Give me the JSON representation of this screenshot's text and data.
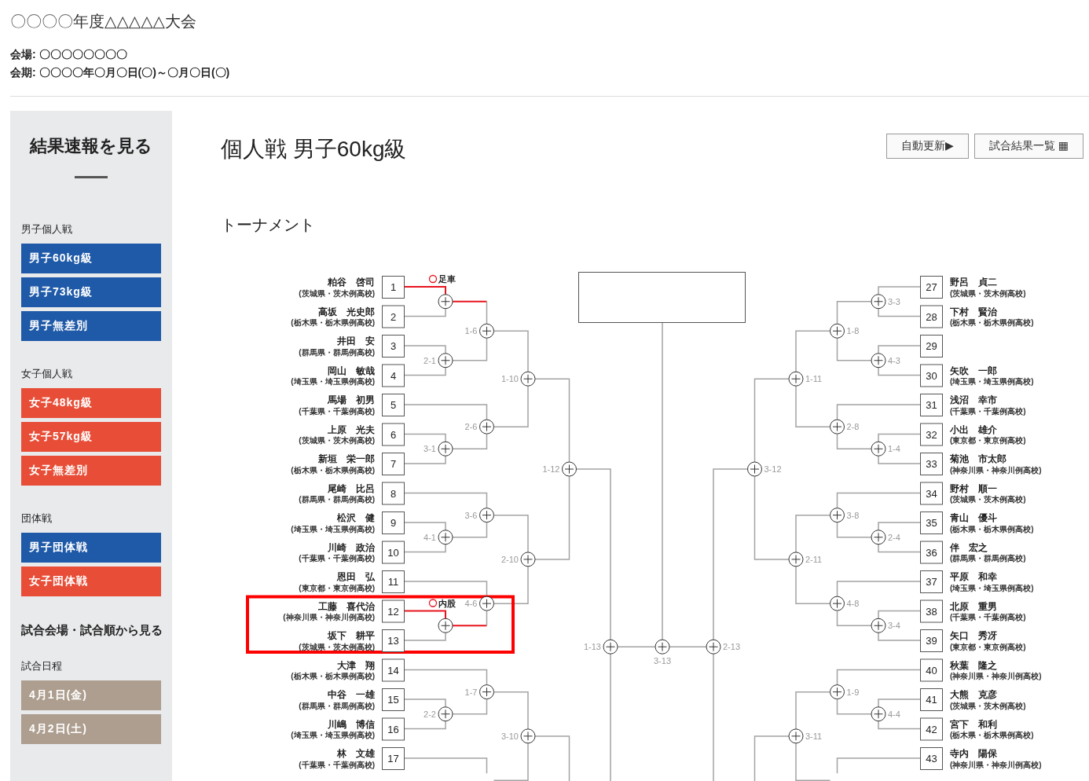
{
  "header": {
    "title": "〇〇〇〇年度△△△△△大会",
    "info": [
      "会場: 〇〇〇〇〇〇〇〇",
      "会期: 〇〇〇〇年〇月〇日(〇)～〇月〇日(〇)"
    ]
  },
  "sidebar": {
    "title": "結果速報を見る",
    "groups": [
      {
        "heading": "男子個人戦",
        "items": [
          {
            "label": "男子60kg級",
            "color": "#1f5aa8"
          },
          {
            "label": "男子73kg級",
            "color": "#1f5aa8"
          },
          {
            "label": "男子無差別",
            "color": "#1f5aa8"
          }
        ]
      },
      {
        "heading": "女子個人戦",
        "items": [
          {
            "label": "女子48kg級",
            "color": "#e84e37"
          },
          {
            "label": "女子57kg級",
            "color": "#e84e37"
          },
          {
            "label": "女子無差別",
            "color": "#e84e37"
          }
        ]
      },
      {
        "heading": "団体戦",
        "items": [
          {
            "label": "男子団体戦",
            "color": "#1f5aa8"
          },
          {
            "label": "女子団体戦",
            "color": "#e84e37"
          }
        ]
      }
    ],
    "section_title": "試合会場・試合順から見る",
    "schedule": {
      "heading": "試合日程",
      "items": [
        {
          "label": "4月1日(金)",
          "color": "#ad9e8f"
        },
        {
          "label": "4月2日(土)",
          "color": "#ad9e8f"
        }
      ]
    }
  },
  "page_title": "個人戦 男子60kg級",
  "toolbar": {
    "buttons": [
      "自動更新▶",
      "試合結果一覧 ▦"
    ]
  },
  "section_heading": "トーナメント",
  "bracket": {
    "left": {
      "entries": [
        {
          "number": "1",
          "name": "粕谷　啓司",
          "school": "(茨城県・茨木例高校)",
          "winner": true
        },
        {
          "number": "2",
          "name": "高坂　光史郎",
          "school": "(栃木県・栃木県例高校)",
          "winner": false
        },
        {
          "number": "3",
          "name": "井田　安",
          "school": "(群馬県・群馬例高校)",
          "winner": false
        },
        {
          "number": "4",
          "name": "岡山　敏哉",
          "school": "(埼玉県・埼玉県例高校)",
          "winner": false
        },
        {
          "number": "5",
          "name": "馬場　初男",
          "school": "(千葉県・千葉例高校)",
          "winner": false
        },
        {
          "number": "6",
          "name": "上原　光夫",
          "school": "(茨城県・茨木例高校)",
          "winner": false
        },
        {
          "number": "7",
          "name": "新垣　栄一郎",
          "school": "(栃木県・栃木県例高校)",
          "winner": false
        },
        {
          "number": "8",
          "name": "尾崎　比呂",
          "school": "(群馬県・群馬例高校)",
          "winner": false
        },
        {
          "number": "9",
          "name": "松沢　健",
          "school": "(埼玉県・埼玉県例高校)",
          "winner": false
        },
        {
          "number": "10",
          "name": "川崎　政治",
          "school": "(千葉県・千葉例高校)",
          "winner": false
        },
        {
          "number": "11",
          "name": "恩田　弘",
          "school": "(東京都・東京例高校)",
          "winner": false
        },
        {
          "number": "12",
          "name": "工藤　喜代治",
          "school": "(神奈川県・神奈川例高校)",
          "winner": true
        },
        {
          "number": "13",
          "name": "坂下　耕平",
          "school": "(茨城県・茨木例高校)",
          "winner": false
        },
        {
          "number": "14",
          "name": "大津　翔",
          "school": "(栃木県・栃木県例高校)",
          "winner": false
        },
        {
          "number": "15",
          "name": "中谷　一雄",
          "school": "(群馬県・群馬例高校)",
          "winner": false
        },
        {
          "number": "16",
          "name": "川嶋　博信",
          "school": "(埼玉県・埼玉県例高校)",
          "winner": false
        },
        {
          "number": "17",
          "name": "林　文雄",
          "school": "(千葉県・千葉例高校)",
          "winner": false
        }
      ],
      "matches": [
        {
          "result": "足車",
          "highlighted": false
        },
        {
          "label": "1-6",
          "highlighted": false
        },
        {
          "label": "2-1",
          "highlighted": false
        },
        {
          "label": "1-10",
          "highlighted": false
        },
        {
          "label": "2-6",
          "highlighted": false
        },
        {
          "label": "3-1",
          "highlighted": false
        },
        {
          "label": "1-12",
          "highlighted": false
        },
        {
          "label": "3-6",
          "highlighted": false
        },
        {
          "label": "4-1",
          "highlighted": false
        },
        {
          "label": "2-10",
          "highlighted": false
        },
        {
          "label": "4-6",
          "highlighted": false
        },
        {
          "result": "内股",
          "highlighted": true
        },
        {
          "label": "1-13",
          "highlighted": false
        },
        {
          "label": "1-7",
          "highlighted": false
        },
        {
          "label": "2-2",
          "highlighted": false
        },
        {
          "label": "3-10",
          "highlighted": false
        }
      ]
    },
    "final": {
      "label": "3-13"
    },
    "right": {
      "entries": [
        {
          "number": "27",
          "name": "野呂　貞二",
          "school": "(茨城県・茨木例高校)",
          "winner": false
        },
        {
          "number": "28",
          "name": "下村　賢治",
          "school": "(栃木県・栃木県例高校)",
          "winner": false
        },
        {
          "number": "29",
          "winner": false
        },
        {
          "number": "30",
          "name": "矢吹　一郎",
          "school": "(埼玉県・埼玉県例高校)",
          "winner": false
        },
        {
          "number": "31",
          "name": "浅沼　幸市",
          "school": "(千葉県・千葉例高校)",
          "winner": false
        },
        {
          "number": "32",
          "name": "小出　雄介",
          "school": "(東京都・東京例高校)",
          "winner": false
        },
        {
          "number": "33",
          "name": "菊池　市太郎",
          "school": "(神奈川県・神奈川例高校)",
          "winner": false
        },
        {
          "number": "34",
          "name": "野村　順一",
          "school": "(茨城県・茨木例高校)",
          "winner": false
        },
        {
          "number": "35",
          "name": "青山　優斗",
          "school": "(栃木県・栃木県例高校)",
          "winner": false
        },
        {
          "number": "36",
          "name": "伴　宏之",
          "school": "(群馬県・群馬例高校)",
          "winner": false
        },
        {
          "number": "37",
          "name": "平原　和幸",
          "school": "(埼玉県・埼玉県例高校)",
          "winner": false
        },
        {
          "number": "38",
          "name": "北原　重男",
          "school": "(千葉県・千葉例高校)",
          "winner": false
        },
        {
          "number": "39",
          "name": "矢口　秀冴",
          "school": "(東京都・東京例高校)",
          "winner": false
        },
        {
          "number": "40",
          "name": "秋葉　隆之",
          "school": "(神奈川県・神奈川例高校)",
          "winner": false
        },
        {
          "number": "41",
          "name": "大熊　克彦",
          "school": "(茨城県・茨木例高校)",
          "winner": false
        },
        {
          "number": "42",
          "name": "宮下　和利",
          "school": "(栃木県・栃木県例高校)",
          "winner": false
        },
        {
          "number": "43",
          "name": "寺内　陽保",
          "school": "(神奈川県・神奈川例高校)",
          "winner": false
        }
      ],
      "matches": [
        {
          "label": "3-3",
          "highlighted": false
        },
        {
          "label": "1-8",
          "highlighted": false
        },
        {
          "label": "4-3",
          "highlighted": false
        },
        {
          "label": "1-11",
          "highlighted": false
        },
        {
          "label": "2-8",
          "highlighted": false
        },
        {
          "label": "1-4",
          "highlighted": false
        },
        {
          "label": "3-12",
          "highlighted": false
        },
        {
          "label": "3-8",
          "highlighted": false
        },
        {
          "label": "2-4",
          "highlighted": false
        },
        {
          "label": "2-11",
          "highlighted": false
        },
        {
          "label": "4-8",
          "highlighted": false
        },
        {
          "label": "3-4",
          "highlighted": false
        },
        {
          "label": "2-13",
          "highlighted": false
        },
        {
          "label": "1-9",
          "highlighted": false
        },
        {
          "label": "4-4",
          "highlighted": false
        },
        {
          "label": "3-11",
          "highlighted": false
        }
      ]
    }
  }
}
